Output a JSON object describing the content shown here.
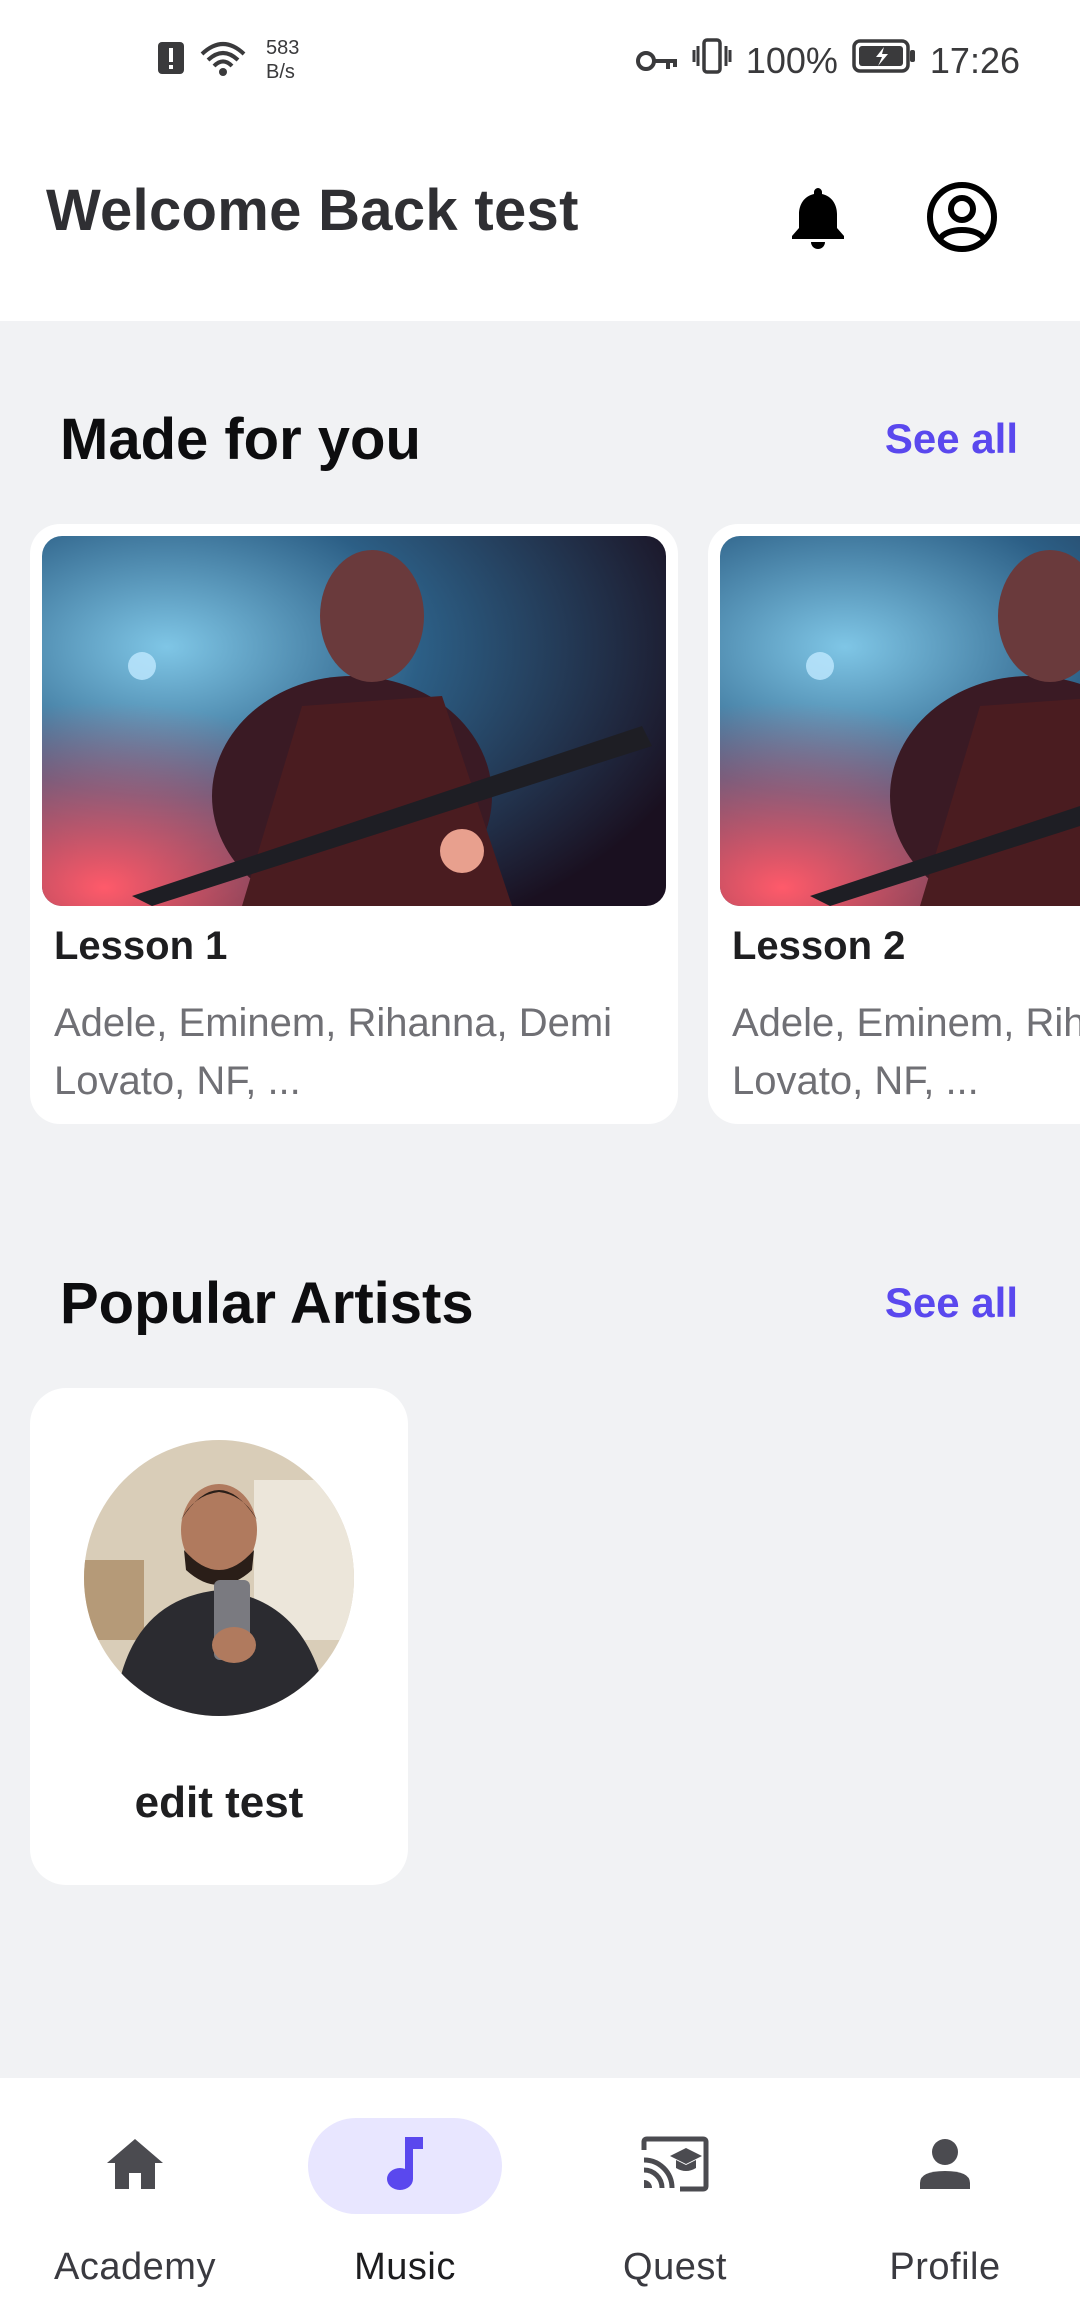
{
  "status_bar": {
    "net_speed_value": "583",
    "net_speed_unit": "B/s",
    "battery": "100%",
    "time": "17:26"
  },
  "header": {
    "title": "Welcome Back test",
    "icons": [
      "bell-icon",
      "account-circle-icon"
    ]
  },
  "made_for_you": {
    "title": "Made for you",
    "see_all": "See all",
    "lessons": [
      {
        "title": "Lesson 1",
        "artists": "Adele, Eminem, Rihanna, Demi Lovato, NF, ...",
        "image": "guitarist-photo"
      },
      {
        "title": "Lesson 2",
        "artists": "Adele, Eminem, Rihanna, Demi Lovato, NF, ...",
        "image": "guitarist-photo"
      }
    ]
  },
  "popular_artists": {
    "title": "Popular Artists",
    "see_all": "See all",
    "artists": [
      {
        "name": "edit test",
        "image": "artist-selfie-photo"
      }
    ]
  },
  "bottom_nav": {
    "items": [
      {
        "label": "Academy",
        "icon": "home-icon",
        "active": false
      },
      {
        "label": "Music",
        "icon": "music-note-icon",
        "active": true
      },
      {
        "label": "Quest",
        "icon": "cast-for-education-icon",
        "active": false
      },
      {
        "label": "Profile",
        "icon": "person-icon",
        "active": false
      }
    ]
  },
  "colors": {
    "accent": "#5a48ee",
    "active_nav_pill": "#e8e6ff",
    "background": "#f1f2f4"
  }
}
